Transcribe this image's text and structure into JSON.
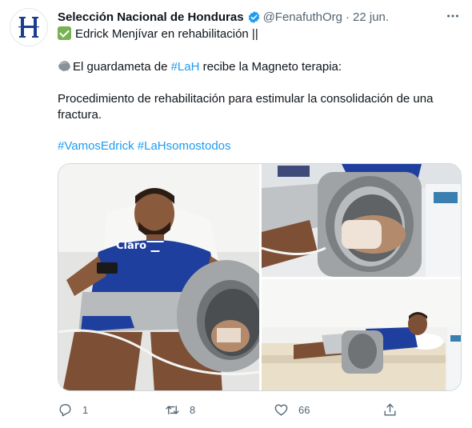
{
  "author": {
    "name": "Selección Nacional de Honduras",
    "handle": "@FenafuthOrg",
    "dot": "·",
    "date": "22 jun.",
    "avatar_icon": "honduras-h-crest",
    "verified_color": "#1d9bf0"
  },
  "tweet": {
    "line1": "Edrick Menjívar en rehabilitación ||",
    "line2_before": "El guardameta de ",
    "line2_tag": "#LaH",
    "line2_after": " recibe la Magneto terapia:",
    "line3": "Procedimiento de rehabilitación para estimular la consolidación de una",
    "line4": "fractura.",
    "tag1": "#VamosEdrick",
    "tag2": "#LaHsomostodos",
    "tag_color": "#1d9bf0"
  },
  "media": {
    "photo1_icon": "photo-patient-with-magnet-device",
    "photo2_icon": "photo-hand-in-magnet-ring",
    "photo3_icon": "photo-patient-lying-on-bed"
  },
  "actions": {
    "reply_count": "1",
    "retweet_count": "8",
    "like_count": "66"
  }
}
